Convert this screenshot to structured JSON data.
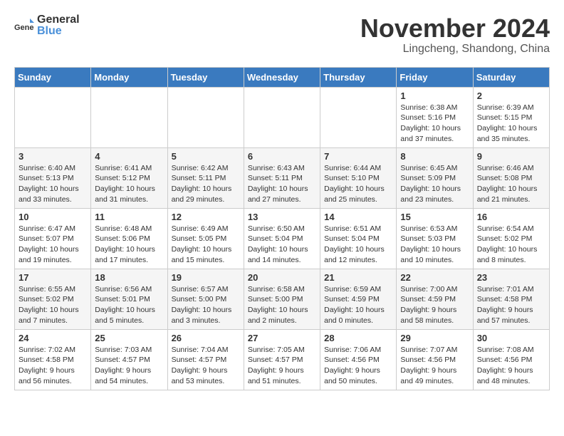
{
  "header": {
    "logo_general": "General",
    "logo_blue": "Blue",
    "title": "November 2024",
    "subtitle": "Lingcheng, Shandong, China"
  },
  "weekdays": [
    "Sunday",
    "Monday",
    "Tuesday",
    "Wednesday",
    "Thursday",
    "Friday",
    "Saturday"
  ],
  "weeks": [
    [
      {
        "day": "",
        "info": ""
      },
      {
        "day": "",
        "info": ""
      },
      {
        "day": "",
        "info": ""
      },
      {
        "day": "",
        "info": ""
      },
      {
        "day": "",
        "info": ""
      },
      {
        "day": "1",
        "info": "Sunrise: 6:38 AM\nSunset: 5:16 PM\nDaylight: 10 hours and 37 minutes."
      },
      {
        "day": "2",
        "info": "Sunrise: 6:39 AM\nSunset: 5:15 PM\nDaylight: 10 hours and 35 minutes."
      }
    ],
    [
      {
        "day": "3",
        "info": "Sunrise: 6:40 AM\nSunset: 5:13 PM\nDaylight: 10 hours and 33 minutes."
      },
      {
        "day": "4",
        "info": "Sunrise: 6:41 AM\nSunset: 5:12 PM\nDaylight: 10 hours and 31 minutes."
      },
      {
        "day": "5",
        "info": "Sunrise: 6:42 AM\nSunset: 5:11 PM\nDaylight: 10 hours and 29 minutes."
      },
      {
        "day": "6",
        "info": "Sunrise: 6:43 AM\nSunset: 5:11 PM\nDaylight: 10 hours and 27 minutes."
      },
      {
        "day": "7",
        "info": "Sunrise: 6:44 AM\nSunset: 5:10 PM\nDaylight: 10 hours and 25 minutes."
      },
      {
        "day": "8",
        "info": "Sunrise: 6:45 AM\nSunset: 5:09 PM\nDaylight: 10 hours and 23 minutes."
      },
      {
        "day": "9",
        "info": "Sunrise: 6:46 AM\nSunset: 5:08 PM\nDaylight: 10 hours and 21 minutes."
      }
    ],
    [
      {
        "day": "10",
        "info": "Sunrise: 6:47 AM\nSunset: 5:07 PM\nDaylight: 10 hours and 19 minutes."
      },
      {
        "day": "11",
        "info": "Sunrise: 6:48 AM\nSunset: 5:06 PM\nDaylight: 10 hours and 17 minutes."
      },
      {
        "day": "12",
        "info": "Sunrise: 6:49 AM\nSunset: 5:05 PM\nDaylight: 10 hours and 15 minutes."
      },
      {
        "day": "13",
        "info": "Sunrise: 6:50 AM\nSunset: 5:04 PM\nDaylight: 10 hours and 14 minutes."
      },
      {
        "day": "14",
        "info": "Sunrise: 6:51 AM\nSunset: 5:04 PM\nDaylight: 10 hours and 12 minutes."
      },
      {
        "day": "15",
        "info": "Sunrise: 6:53 AM\nSunset: 5:03 PM\nDaylight: 10 hours and 10 minutes."
      },
      {
        "day": "16",
        "info": "Sunrise: 6:54 AM\nSunset: 5:02 PM\nDaylight: 10 hours and 8 minutes."
      }
    ],
    [
      {
        "day": "17",
        "info": "Sunrise: 6:55 AM\nSunset: 5:02 PM\nDaylight: 10 hours and 7 minutes."
      },
      {
        "day": "18",
        "info": "Sunrise: 6:56 AM\nSunset: 5:01 PM\nDaylight: 10 hours and 5 minutes."
      },
      {
        "day": "19",
        "info": "Sunrise: 6:57 AM\nSunset: 5:00 PM\nDaylight: 10 hours and 3 minutes."
      },
      {
        "day": "20",
        "info": "Sunrise: 6:58 AM\nSunset: 5:00 PM\nDaylight: 10 hours and 2 minutes."
      },
      {
        "day": "21",
        "info": "Sunrise: 6:59 AM\nSunset: 4:59 PM\nDaylight: 10 hours and 0 minutes."
      },
      {
        "day": "22",
        "info": "Sunrise: 7:00 AM\nSunset: 4:59 PM\nDaylight: 9 hours and 58 minutes."
      },
      {
        "day": "23",
        "info": "Sunrise: 7:01 AM\nSunset: 4:58 PM\nDaylight: 9 hours and 57 minutes."
      }
    ],
    [
      {
        "day": "24",
        "info": "Sunrise: 7:02 AM\nSunset: 4:58 PM\nDaylight: 9 hours and 56 minutes."
      },
      {
        "day": "25",
        "info": "Sunrise: 7:03 AM\nSunset: 4:57 PM\nDaylight: 9 hours and 54 minutes."
      },
      {
        "day": "26",
        "info": "Sunrise: 7:04 AM\nSunset: 4:57 PM\nDaylight: 9 hours and 53 minutes."
      },
      {
        "day": "27",
        "info": "Sunrise: 7:05 AM\nSunset: 4:57 PM\nDaylight: 9 hours and 51 minutes."
      },
      {
        "day": "28",
        "info": "Sunrise: 7:06 AM\nSunset: 4:56 PM\nDaylight: 9 hours and 50 minutes."
      },
      {
        "day": "29",
        "info": "Sunrise: 7:07 AM\nSunset: 4:56 PM\nDaylight: 9 hours and 49 minutes."
      },
      {
        "day": "30",
        "info": "Sunrise: 7:08 AM\nSunset: 4:56 PM\nDaylight: 9 hours and 48 minutes."
      }
    ]
  ]
}
